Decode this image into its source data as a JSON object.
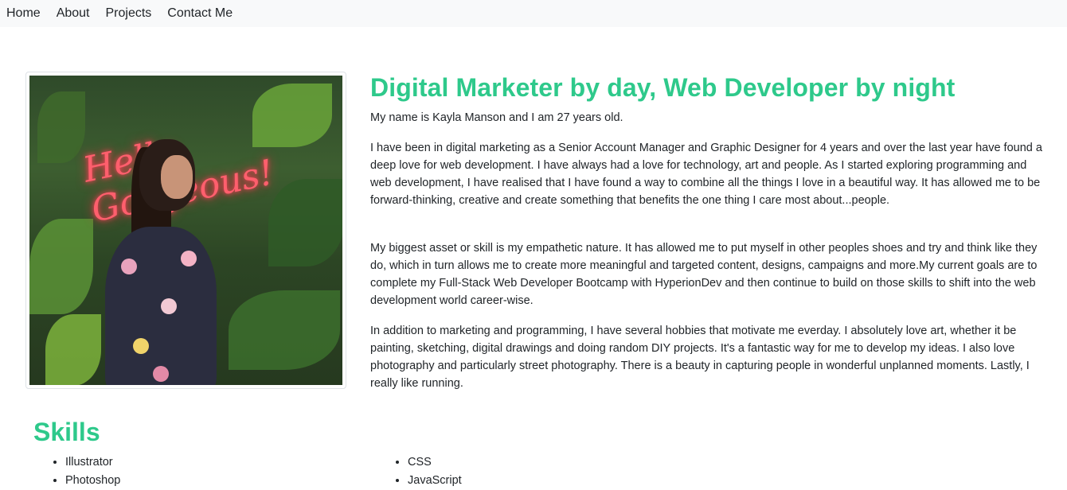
{
  "nav": {
    "items": [
      "Home",
      "About",
      "Projects",
      "Contact Me"
    ]
  },
  "profile": {
    "photo_alt": "Hello Gorgeous!",
    "heading": "Digital Marketer by day, Web Developer by night",
    "intro": "My name is Kayla Manson and I am 27 years old.",
    "paragraphs": [
      "I have been in digital marketing as a Senior Account Manager and Graphic Designer for 4 years and over the last year have found a deep love for web development. I have always had a love for technology, art and people. As I started exploring programming and web development, I have realised that I have found a way to combine all the things I love in a beautiful way. It has allowed me to be forward-thinking, creative and create something that benefits the one thing I care most about...people.",
      "My biggest asset or skill is my empathetic nature. It has allowed me to put myself in other peoples shoes and try and think like they do, which in turn allows me to create more meaningful and targeted content, designs, campaigns and more.My current goals are to complete my Full-Stack Web Developer Bootcamp with HyperionDev and then continue to build on those skills to shift into the web development world career-wise.",
      "In addition to marketing and programming, I have several hobbies that motivate me everday. I absolutely love art, whether it be painting, sketching, digital drawings and doing random DIY projects. It's a fantastic way for me to develop my ideas. I also love photography and particularly street photography. There is a beauty in capturing people in wonderful unplanned moments. Lastly, I really like running."
    ]
  },
  "skills": {
    "title": "Skills",
    "left": [
      "Illustrator",
      "Photoshop"
    ],
    "right": [
      "CSS",
      "JavaScript"
    ]
  },
  "colors": {
    "accent": "#2ec98b",
    "navbar_bg": "#f8f9fa",
    "text": "#212529"
  }
}
